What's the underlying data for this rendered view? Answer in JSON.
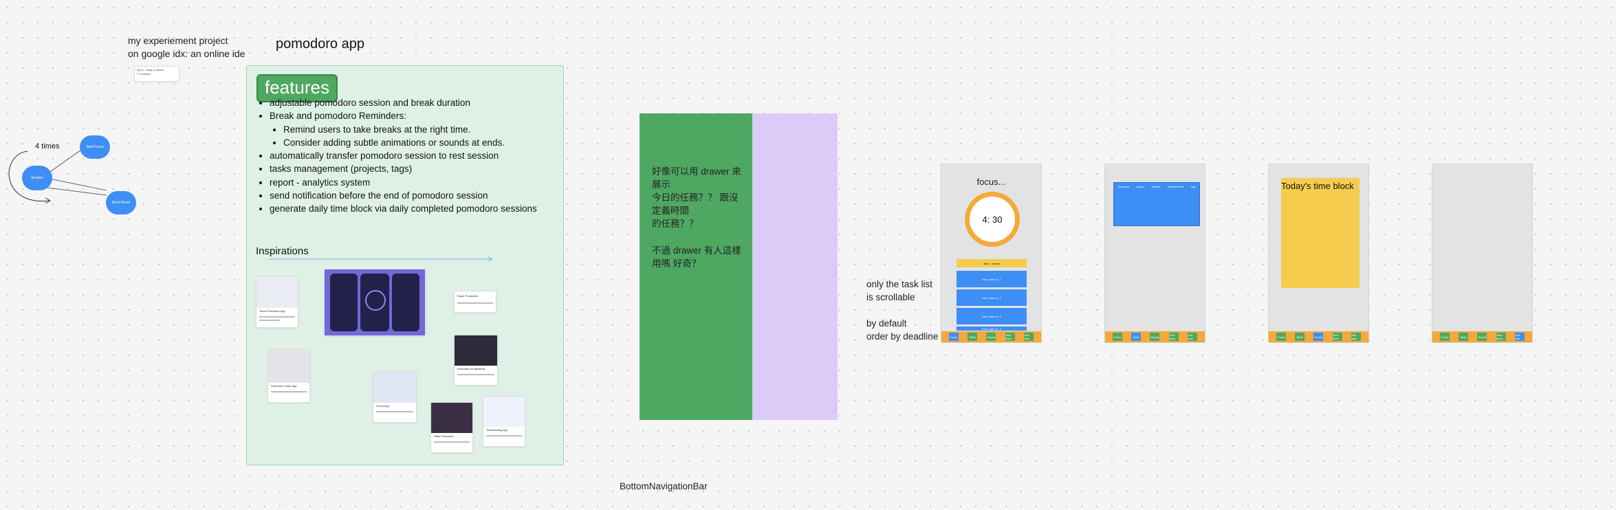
{
  "canvas": {
    "intro_note_line1": "my experiement project",
    "intro_note_line2": "on google idx: an online ide",
    "small_card_line1": "figma : stage & assets",
    "small_card_line2": "↗ localhost",
    "app_title": "pomodoro app",
    "flow": {
      "loop_label": "4 times",
      "node_focus": "Start Focus",
      "node_session": "Session",
      "node_break": "Short Break"
    }
  },
  "features": {
    "title": "features",
    "items": [
      "adjustable pomodoro session and break duration",
      "Break and pomodoro Reminders:",
      "automatically transfer pomodoro session to rest session",
      "tasks management (projects, tags)",
      "report - analytics system",
      "send notification before the end of pomodoro session",
      "generate daily time block via daily completed pomodoro sessions"
    ],
    "sub_items": [
      "Remind users to take breaks at the right time.",
      "Consider adding subtle animations or sounds at ends."
    ],
    "inspirations_title": "Inspirations",
    "inspiration_cards": [
      "Timer Pomodoro App",
      "Daily Pomodoro",
      "Super Pomodoro",
      "Pomodoro Productivity",
      "Pomodoro Timer App",
      "Focus App",
      "Timeblocking App"
    ]
  },
  "drawer_note": {
    "text1": "好像可以用 drawer 來\n展示\n今日的任務？？ 跟沒\n定義時間\n的任務？？",
    "text2": "不過 drawer 有人這樣\n用嗎 好奇？"
  },
  "bottom_nav_label": "BottomNavigationBar",
  "task_note": {
    "line1": "only the task list",
    "line2": "is scrollable",
    "line3": "by default",
    "line4": "order by deadline"
  },
  "screen1": {
    "focus_label": "focus...",
    "timer": "4: 30",
    "current_task": "Task · current",
    "tasks": [
      "todo: task no. 1",
      "todo: task no. 2",
      "todo: task no. 3",
      "todo: task no. 4"
    ],
    "nav": [
      "Focus",
      "Tasks",
      "Report",
      "Time block",
      "Add task"
    ]
  },
  "screen2": {
    "table_headers": [
      "Task name",
      "project",
      "deadline",
      "estimated time",
      "tags"
    ],
    "nav": [
      "Focus",
      "Tasks",
      "Report",
      "Time block",
      "Add task"
    ]
  },
  "screen3": {
    "title": "Today's time block",
    "nav": [
      "Focus",
      "Tasks",
      "Report",
      "Time block",
      "Add task"
    ]
  },
  "screen4": {
    "nav": [
      "Focus",
      "Tasks",
      "Report",
      "Time block",
      "Add task"
    ]
  },
  "colors": {
    "green": "#4fa862",
    "lavender": "#dccbf7",
    "blue": "#3d8ef5",
    "orange": "#f4a93a",
    "yellow": "#f5cc4d"
  }
}
